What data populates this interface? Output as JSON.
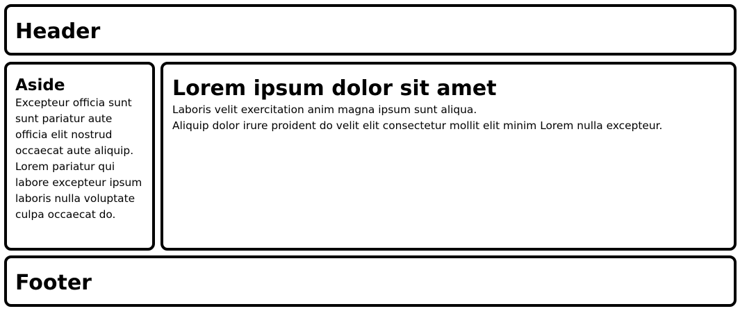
{
  "header": {
    "title": "Header"
  },
  "aside": {
    "title": "Aside",
    "text": "Excepteur officia sunt sunt pariatur aute officia elit nostrud occaecat aute aliquip. Lorem pariatur qui labore excepteur ipsum laboris nulla voluptate culpa occaecat do."
  },
  "main": {
    "title": "Lorem ipsum dolor sit amet",
    "paragraph1": "Laboris velit exercitation anim magna ipsum sunt aliqua.",
    "paragraph2": "Aliquip dolor irure proident do velit elit consectetur mollit elit minim Lorem nulla excepteur."
  },
  "footer": {
    "title": "Footer"
  }
}
